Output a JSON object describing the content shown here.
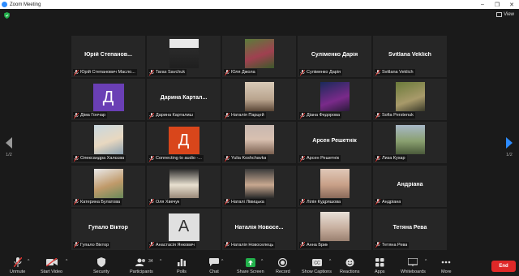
{
  "window": {
    "title": "Zoom Meeting"
  },
  "top": {
    "view_label": "View"
  },
  "pagination": {
    "left": "1/2",
    "right": "1/2"
  },
  "tiles": [
    {
      "big": "Юрій Степанов...",
      "caption": "Юрій Степанович Масло..."
    },
    {
      "big": "",
      "caption": "Taras Savchuk"
    },
    {
      "big": "",
      "caption": "Юля Джола"
    },
    {
      "big": "Суліменко Дарія",
      "caption": "Суліменко Дарія"
    },
    {
      "big": "Svitlana Veklich",
      "caption": "Svitlana Veklich"
    },
    {
      "big": "",
      "caption": "Діма Гончар",
      "letter": "Д"
    },
    {
      "big": "Дарина Картал...",
      "caption": "Дарина Карталиш"
    },
    {
      "big": "",
      "caption": "Наталія Парцей"
    },
    {
      "big": "",
      "caption": "Діана Федорова"
    },
    {
      "big": "",
      "caption": "Sofia Perstenuk"
    },
    {
      "big": "",
      "caption": "Олександра Халєєва"
    },
    {
      "big": "",
      "caption": "Connecting to audio -...",
      "letter": "Д"
    },
    {
      "big": "",
      "caption": "Yulia Koshchavka"
    },
    {
      "big": "Арсен Решетнік",
      "caption": "Арсен Решетнік"
    },
    {
      "big": "",
      "caption": "Лиза Кухар"
    },
    {
      "big": "",
      "caption": "Катерина Булатова"
    },
    {
      "big": "",
      "caption": "Оля Хвечук"
    },
    {
      "big": "",
      "caption": "Наталі Лівицька"
    },
    {
      "big": "",
      "caption": "Лілія Кудряшова"
    },
    {
      "big": "Андріана",
      "caption": "Андріана"
    },
    {
      "big": "Гупало Віктор",
      "caption": "Гупало Віктор"
    },
    {
      "big": "",
      "caption": "Анастасія Янкович",
      "letter": "A"
    },
    {
      "big": "Наталія Новосе...",
      "caption": "Наталія Новоселець"
    },
    {
      "big": "",
      "caption": "Анна Брик"
    },
    {
      "big": "Тетяна Рева",
      "caption": "Тетяна Рева"
    }
  ],
  "toolbar": {
    "unmute": "Unmute",
    "start_video": "Start Video",
    "security": "Security",
    "participants": "Participants",
    "participants_count": "34",
    "polls": "Polls",
    "chat": "Chat",
    "share_screen": "Share Screen",
    "record": "Record",
    "show_captions": "Show Captions",
    "reactions": "Reactions",
    "apps": "Apps",
    "whiteboards": "Whiteboards",
    "more": "More",
    "end": "End"
  },
  "colors": {
    "accent": "#2d8cff",
    "share_green": "#22b14c",
    "end_red": "#e02828",
    "mute_red": "#e53935",
    "tile_bg": "#262626"
  }
}
